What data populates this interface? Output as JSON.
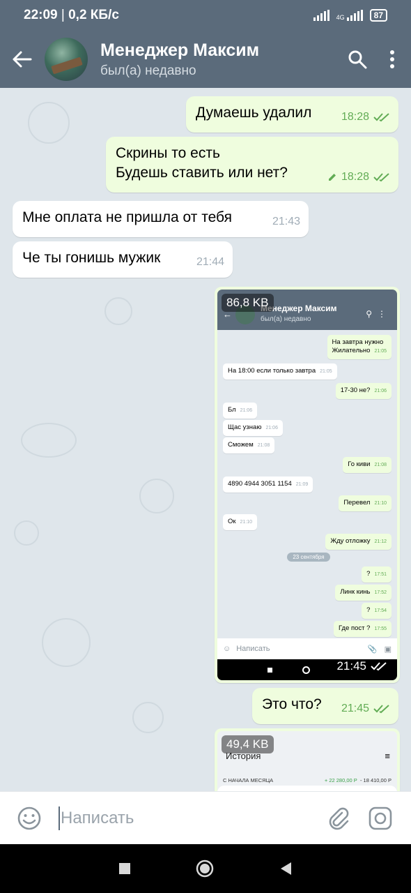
{
  "status_bar": {
    "time": "22:09",
    "speed": "0,2 КБ/с",
    "network_tag": "4G",
    "battery": "87"
  },
  "header": {
    "name": "Менеджер Максим",
    "status": "был(а) недавно"
  },
  "messages": [
    {
      "type": "out",
      "text": "Думаешь удалил",
      "time": "18:28"
    },
    {
      "type": "out",
      "lines": [
        "Скрины то есть",
        "Будешь ставить или нет?"
      ],
      "time": "18:28",
      "edited": true
    },
    {
      "type": "in",
      "text": "Мне оплата не пришла от тебя",
      "time": "21:43"
    },
    {
      "type": "in",
      "text": "Че ты гонишь мужик",
      "time": "21:44"
    },
    {
      "type": "media",
      "size": "86,8 KB",
      "time": "21:45",
      "screenshot": {
        "header_name": "Менеджер Максим",
        "header_status": "был(а) недавно",
        "input_placeholder": "Написать",
        "messages": [
          {
            "dir": "out",
            "text": "На завтра нужно",
            "text2": "Жилательно",
            "time": "21:05"
          },
          {
            "dir": "in",
            "text": "На 18:00 если только завтра",
            "time": "21:05"
          },
          {
            "dir": "out",
            "text": "17-30 не?",
            "time": "21:06"
          },
          {
            "dir": "in",
            "text": "Бл",
            "time": "21:06"
          },
          {
            "dir": "in",
            "text": "Щас узнаю",
            "time": "21:06"
          },
          {
            "dir": "in",
            "text": "Сможем",
            "time": "21:08"
          },
          {
            "dir": "out",
            "text": "Го киви",
            "time": "21:08"
          },
          {
            "dir": "in",
            "text": "4890 4944 3051 1154",
            "time": "21:09"
          },
          {
            "dir": "out",
            "text": "Перевел",
            "time": "21:10"
          },
          {
            "dir": "in",
            "text": "Ок",
            "time": "21:10"
          },
          {
            "dir": "out",
            "text": "Жду отложку",
            "time": "21:12"
          },
          {
            "dir": "out",
            "text": "?",
            "time": "17:51"
          },
          {
            "dir": "out",
            "text": "Линк кинь",
            "time": "17:52"
          },
          {
            "dir": "out",
            "text": "?",
            "time": "17:54"
          },
          {
            "dir": "out",
            "text": "Где пост ?",
            "time": "17:55"
          }
        ],
        "date_separator": "23 сентября"
      }
    },
    {
      "type": "out",
      "text": "Это что?",
      "time": "21:45"
    },
    {
      "type": "media",
      "size": "49,4 KB",
      "screenshot": {
        "title": "История",
        "row_label": "С НАЧАЛА МЕСЯЦА",
        "row_plus": "+ 22 280,00 Р",
        "row_minus": "- 18 410,00 Р"
      }
    }
  ],
  "input": {
    "placeholder": "Написать"
  },
  "colors": {
    "header": "#5b6b7b",
    "outgoing_bubble": "#effdde",
    "incoming_bubble": "#ffffff",
    "check_green": "#62ac55",
    "chat_bg": "#dfe6eb"
  },
  "icons": [
    "back-arrow-icon",
    "search-icon",
    "more-vertical-icon",
    "double-check-icon",
    "edit-pencil-icon",
    "emoji-icon",
    "attach-icon",
    "camera-icon",
    "nav-square-icon",
    "nav-circle-icon",
    "nav-back-icon"
  ]
}
